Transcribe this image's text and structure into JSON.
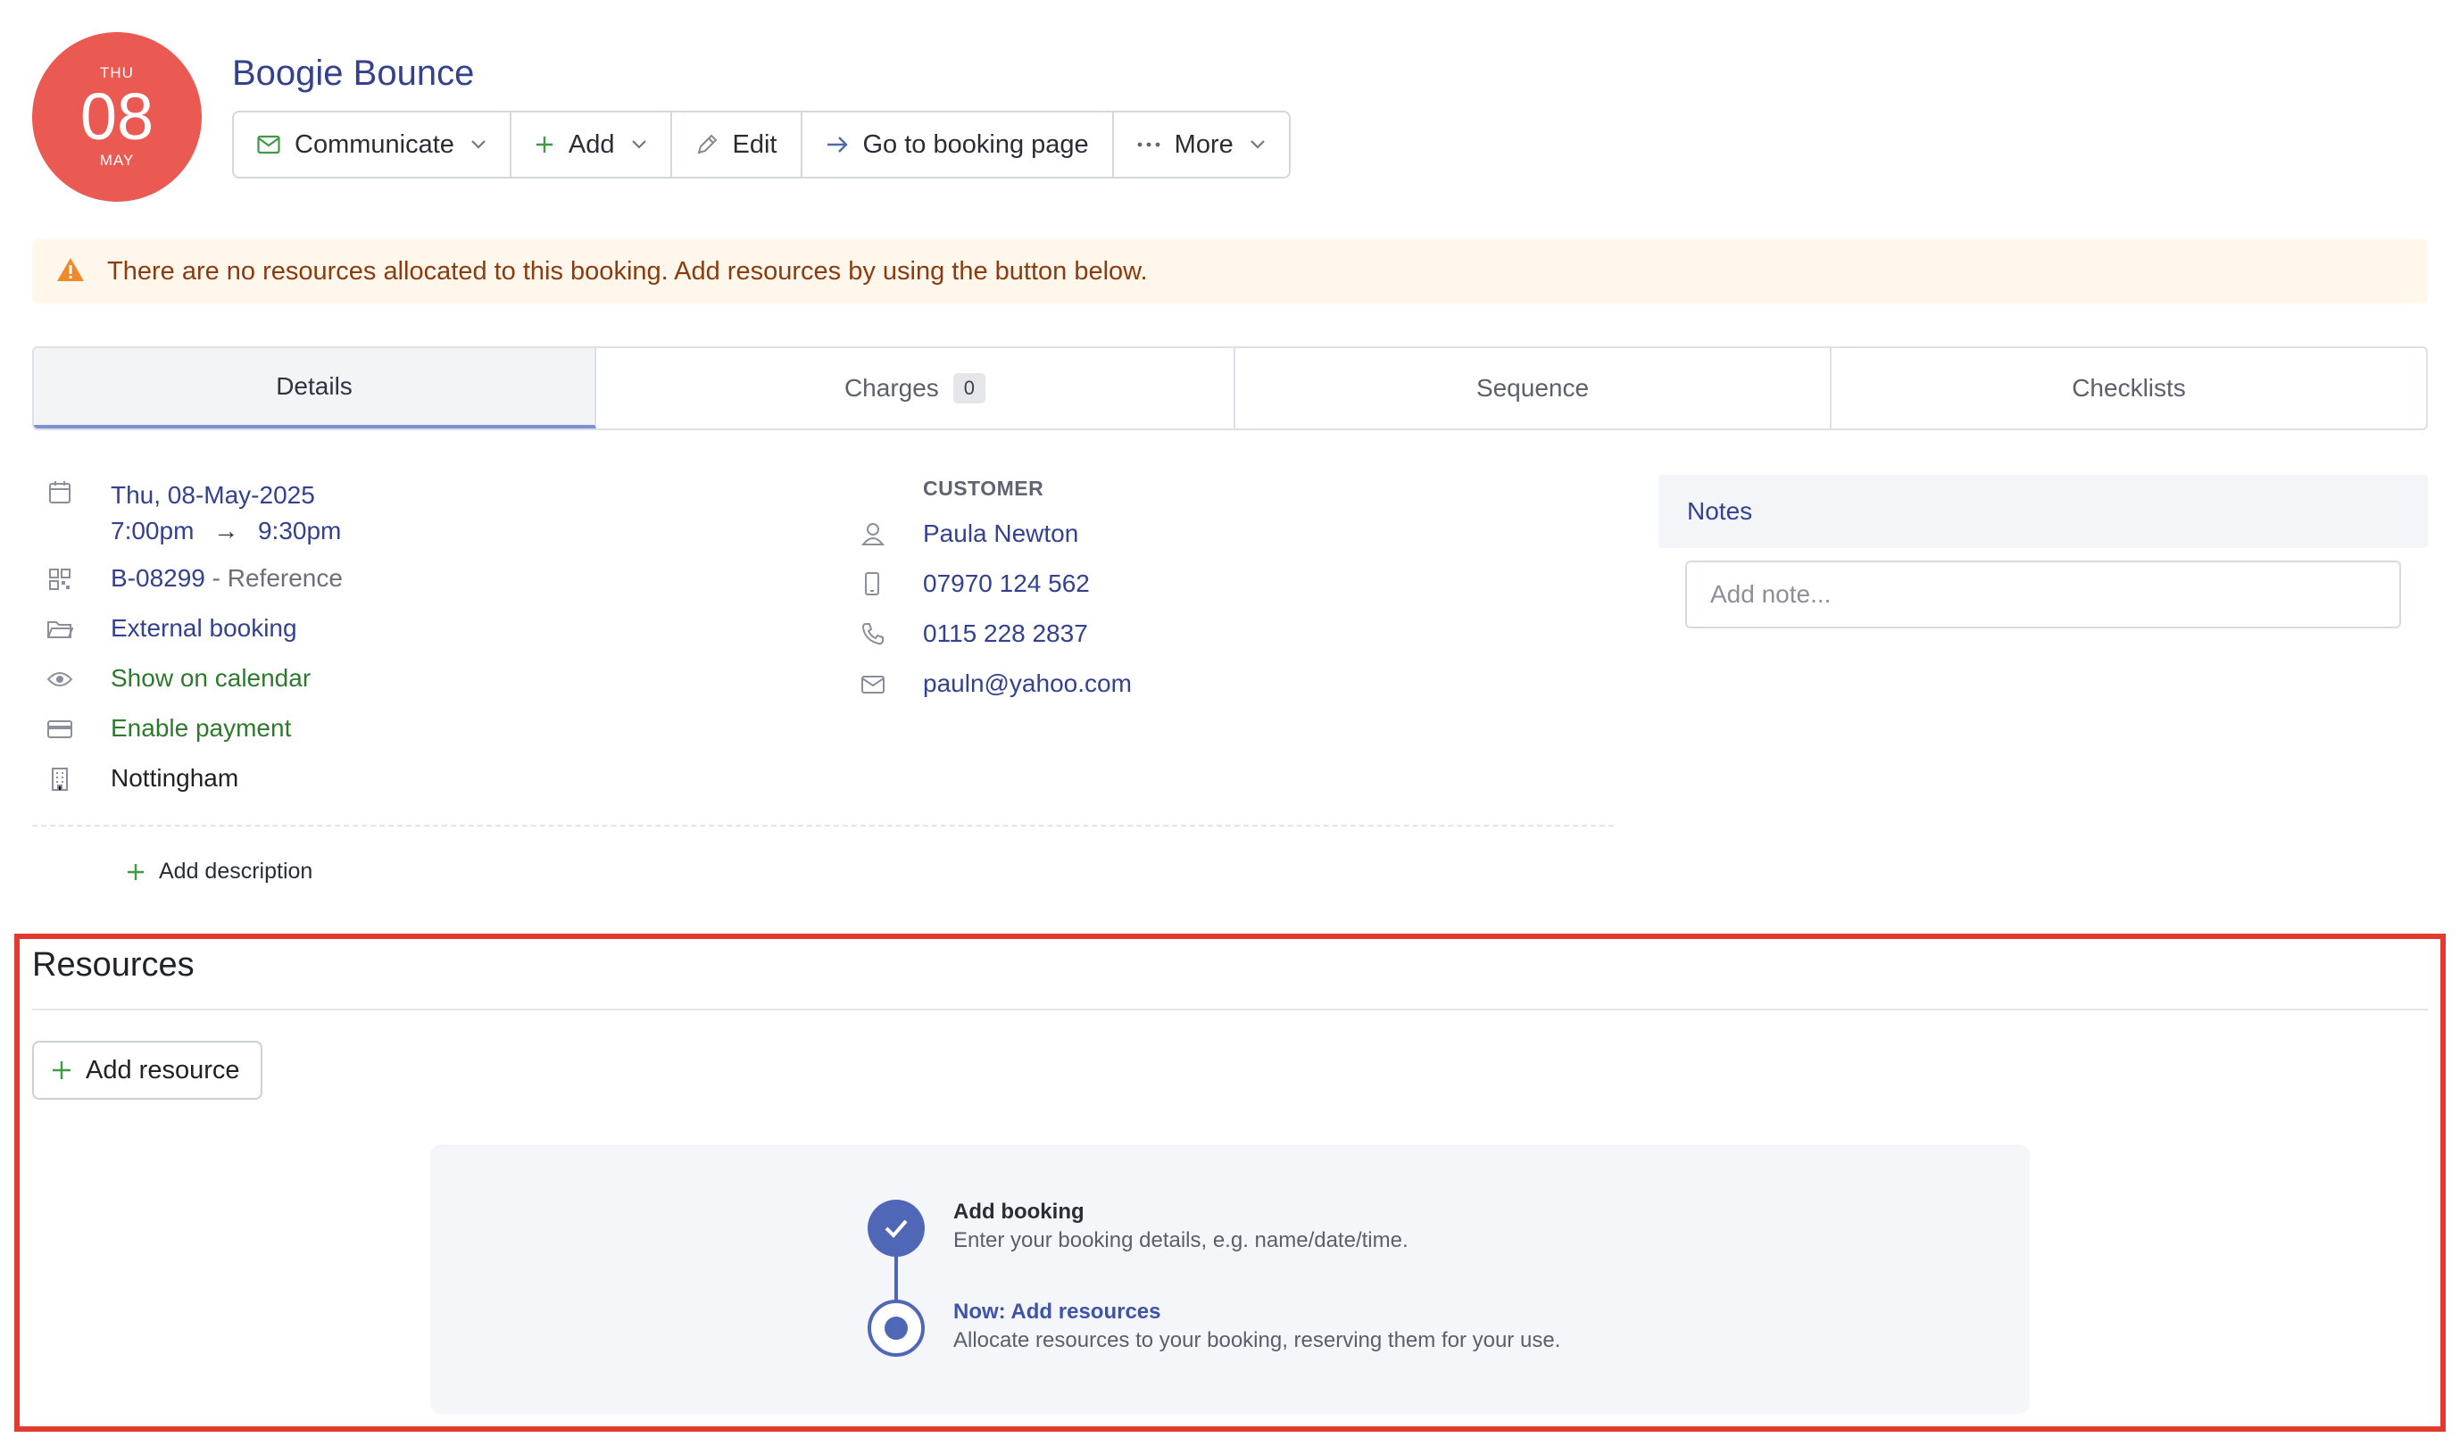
{
  "booking": {
    "date_badge": {
      "dow": "THU",
      "day": "08",
      "month": "MAY"
    },
    "title": "Boogie Bounce"
  },
  "toolbar": {
    "communicate": "Communicate",
    "add": "Add",
    "edit": "Edit",
    "go_to_booking_page": "Go to booking page",
    "more": "More"
  },
  "alert": {
    "text": "There are no resources allocated to this booking. Add resources by using the button below."
  },
  "tabs": {
    "details": "Details",
    "charges": "Charges",
    "charges_count": "0",
    "sequence": "Sequence",
    "checklists": "Checklists"
  },
  "details": {
    "date": "Thu, 08-May-2025",
    "start_time": "7:00pm",
    "arrow": "→",
    "end_time": "9:30pm",
    "reference_id": "B-08299",
    "reference_label": " - Reference",
    "source": "External booking",
    "calendar": "Show on calendar",
    "payment": "Enable payment",
    "location": "Nottingham",
    "add_description": "Add description"
  },
  "customer": {
    "label": "CUSTOMER",
    "name": "Paula Newton",
    "mobile": "07970 124 562",
    "phone": "0115 228 2837",
    "email": "pauln@yahoo.com"
  },
  "notes": {
    "title": "Notes",
    "placeholder": "Add note..."
  },
  "resources": {
    "title": "Resources",
    "add_button": "Add resource",
    "steps": [
      {
        "title": "Add booking",
        "desc": "Enter your booking details, e.g. name/date/time."
      },
      {
        "title": "Now: Add resources",
        "desc": "Allocate resources to your booking, reserving them for your use."
      }
    ]
  },
  "colors": {
    "brand_blue": "#34418f",
    "badge_red": "#ea5a52",
    "success_green": "#2d7a2f",
    "step_blue": "#5066b6",
    "highlight_red": "#e23a2e"
  }
}
